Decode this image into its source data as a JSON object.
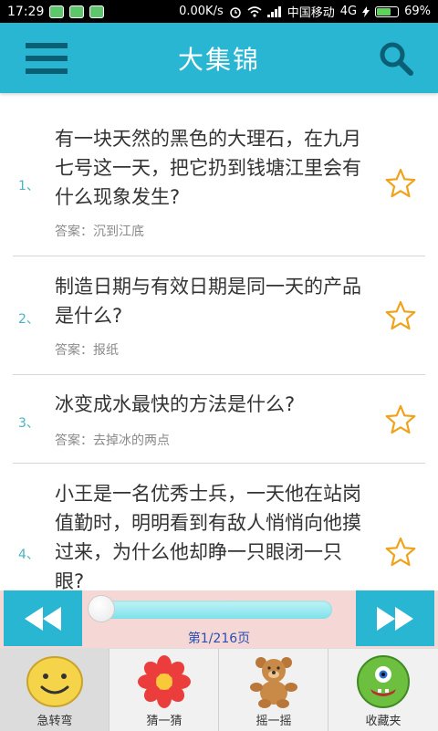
{
  "status_bar": {
    "time": "17:29",
    "net_speed": "0.00K/s",
    "carrier": "中国移动",
    "network": "4G",
    "battery_percent": "69%",
    "battery_level": 0.69
  },
  "header": {
    "title": "大集锦",
    "menu_icon": "menu-icon",
    "search_icon": "search-icon",
    "bar_color": "#29b6d3"
  },
  "items": [
    {
      "index": "1、",
      "question": "有一块天然的黑色的大理石，在九月七号这一天，把它扔到钱塘江里会有什么现象发生?",
      "answer": "答案：沉到江底",
      "favorite": false
    },
    {
      "index": "2、",
      "question": "制造日期与有效日期是同一天的产品是什么?",
      "answer": "答案：报纸",
      "favorite": false
    },
    {
      "index": "3、",
      "question": "冰变成水最快的方法是什么?",
      "answer": "答案：去掉冰的两点",
      "favorite": false
    },
    {
      "index": "4、",
      "question": "小王是一名优秀士兵，一天他在站岗值勤时，明明看到有敌人悄悄向他摸过来，为什么他却睁一只眼闭一只眼?",
      "answer": "",
      "favorite": false
    }
  ],
  "pager": {
    "page_label": "第1/216页",
    "current_page": 1,
    "total_pages": 216,
    "prev_icon": "rewind-icon",
    "next_icon": "fast-forward-icon"
  },
  "tabs": [
    {
      "label": "急转弯",
      "icon": "smiley-face-icon",
      "active": true
    },
    {
      "label": "猜一猜",
      "icon": "flower-icon",
      "active": false
    },
    {
      "label": "摇一摇",
      "icon": "teddy-bear-icon",
      "active": false
    },
    {
      "label": "收藏夹",
      "icon": "monster-icon",
      "active": false
    }
  ]
}
